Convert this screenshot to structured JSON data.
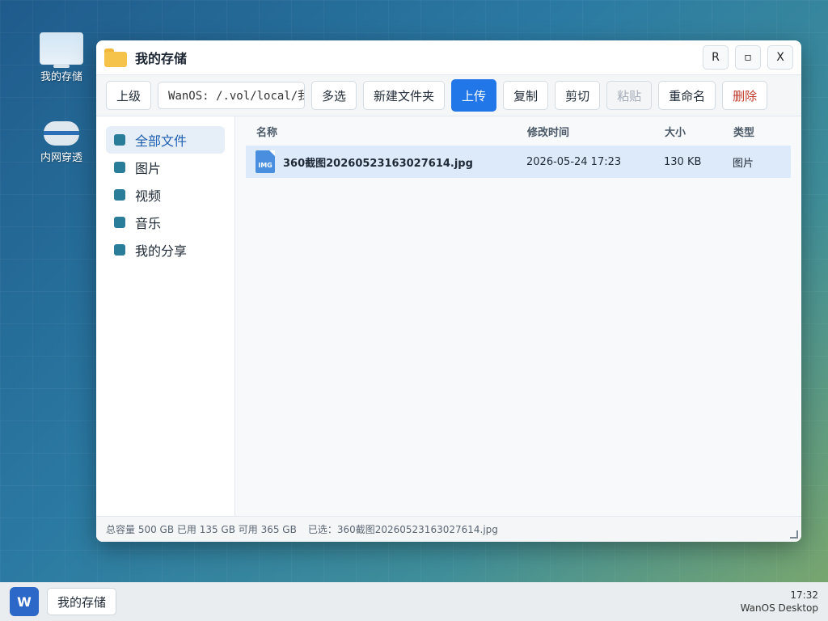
{
  "desktop": {
    "icons": [
      {
        "label": "我的存储"
      },
      {
        "label": "内网穿透"
      }
    ]
  },
  "window": {
    "title": "我的存储",
    "controls": {
      "r": "R",
      "maximize": "▫",
      "close": "X"
    }
  },
  "toolbar": {
    "up": "上级",
    "path": "WanOS: /.vol/local/我",
    "multi_select": "多选",
    "new_folder": "新建文件夹",
    "upload": "上传",
    "copy": "复制",
    "cut": "剪切",
    "paste": "粘贴",
    "rename": "重命名",
    "delete": "删除"
  },
  "sidebar": {
    "items": [
      {
        "label": "全部文件",
        "active": true
      },
      {
        "label": "图片"
      },
      {
        "label": "视频"
      },
      {
        "label": "音乐"
      },
      {
        "label": "我的分享"
      }
    ]
  },
  "table": {
    "headers": {
      "name": "名称",
      "time": "修改时间",
      "size": "大小",
      "type": "类型"
    },
    "rows": [
      {
        "icon": "IMG",
        "name": "360截图20260523163027614.jpg",
        "time": "2026-05-24 17:23",
        "size": "130 KB",
        "type": "图片",
        "selected": true
      }
    ]
  },
  "status": {
    "capacity": "总容量 500 GB 已用 135 GB 可用 365 GB",
    "selected": "已选：360截图20260523163027614.jpg"
  },
  "taskbar": {
    "start": "W",
    "item": "我的存储",
    "time": "17:32",
    "name": "WanOS Desktop"
  },
  "colors": {
    "accent": "#2277e8",
    "danger": "#c0392b",
    "selected_row": "#dceaf9"
  }
}
